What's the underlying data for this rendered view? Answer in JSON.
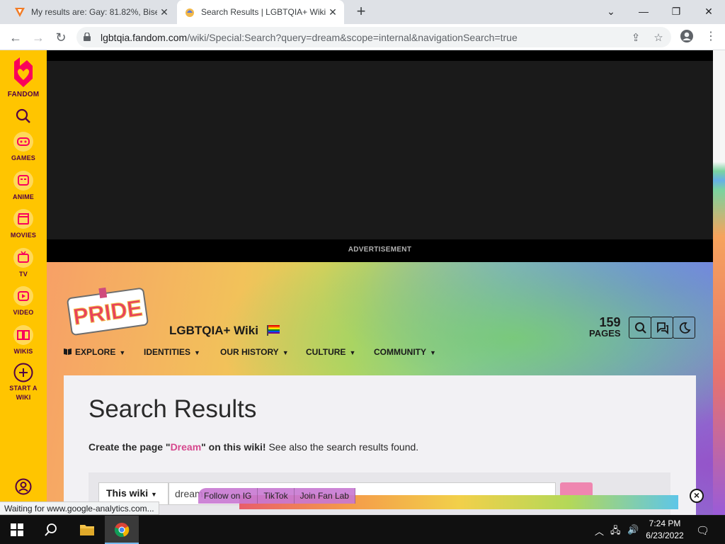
{
  "browser": {
    "tabs": [
      {
        "title": "My results are: Gay: 81.82%, Bise",
        "active": false
      },
      {
        "title": "Search Results | LGBTQIA+ Wiki |",
        "active": true
      }
    ],
    "new_tab": "+",
    "url_host": "lgbtqia.fandom.com",
    "url_rest": "/wiki/Special:Search?query=dream&scope=internal&navigationSearch=true",
    "status": "Waiting for www.google-analytics.com..."
  },
  "rail": {
    "brand": "FANDOM",
    "items": [
      {
        "label": "GAMES",
        "icon": "gamepad-icon"
      },
      {
        "label": "ANIME",
        "icon": "anime-icon"
      },
      {
        "label": "MOVIES",
        "icon": "clapperboard-icon"
      },
      {
        "label": "TV",
        "icon": "tv-icon"
      },
      {
        "label": "VIDEO",
        "icon": "play-icon"
      },
      {
        "label": "WIKIS",
        "icon": "book-icon"
      }
    ],
    "start_wiki_1": "START A",
    "start_wiki_2": "WIKI"
  },
  "ad": {
    "label": "ADVERTISEMENT"
  },
  "wiki": {
    "logo_text": "PRIDE",
    "name": "LGBTQIA+ Wiki",
    "page_count": "159",
    "pages_label": "PAGES",
    "nav": [
      "EXPLORE",
      "IDENTITIES",
      "OUR HISTORY",
      "CULTURE",
      "COMMUNITY"
    ]
  },
  "content": {
    "title": "Search Results",
    "create_prefix": "Create the page \"",
    "create_term": "Dream",
    "create_suffix": "\" on this wiki!",
    "see_also": " See also the search results found.",
    "scope_label": "This wiki",
    "query": "dream"
  },
  "promo": {
    "links": [
      "Follow on IG",
      "TikTok",
      "Join Fan Lab"
    ],
    "close": "×"
  },
  "taskbar": {
    "time": "7:24 PM",
    "date": "6/23/2022"
  },
  "colors": {
    "rail": "#ffc500",
    "accent_pink": "#d6478d",
    "fandom_red": "#fa005a"
  }
}
